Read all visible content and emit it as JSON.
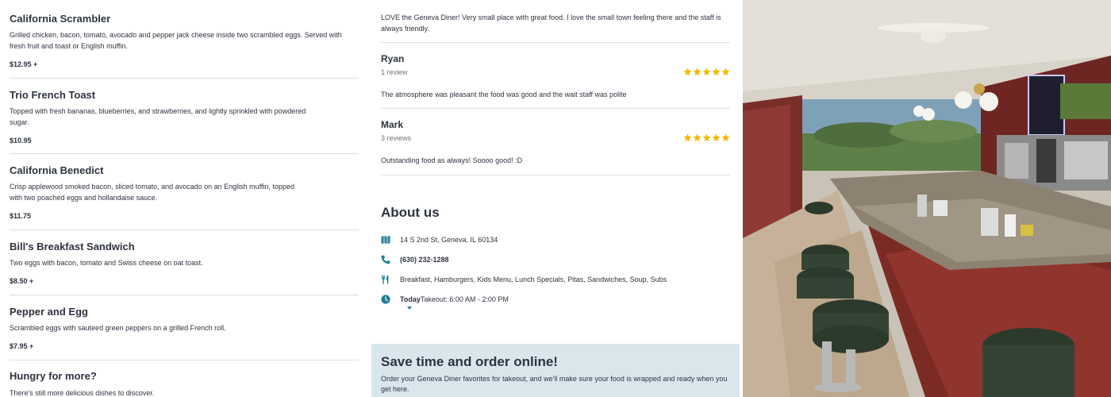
{
  "menu": {
    "items": [
      {
        "name": "California Scrambler",
        "description": "Grilled chicken, bacon, tomato, avocado and pepper jack cheese inside two scrambled eggs. Served with fresh fruit and toast or English muffin.",
        "price": "$12.95 +"
      },
      {
        "name": "Trio French Toast",
        "description": "Topped with fresh bananas, blueberries, and strawberries, and lightly sprinkled with powdered sugar.",
        "price": "$10.95"
      },
      {
        "name": "California Benedict",
        "description": "Crisp applewood smoked bacon, sliced tomato, and avocado on an English muffin, topped with two poached eggs and hollandaise sauce.",
        "price": "$11.75"
      },
      {
        "name": "Bill's Breakfast Sandwich",
        "description": "Two eggs with bacon, tomato and Swiss cheese on oat toast.",
        "price": "$8.50 +"
      },
      {
        "name": "Pepper and Egg",
        "description": "Scrambled eggs with sauteed green peppers on a grilled French roll.",
        "price": "$7.95 +"
      }
    ],
    "more_title": "Hungry for more?",
    "more_subtitle": "There's still more delicious dishes to discover."
  },
  "reviews": {
    "top_text": "LOVE the Geneva Diner! Very small place with great food. I love the small town feeling there and the staff is always friendly.",
    "items": [
      {
        "name": "Ryan",
        "count": "1 review",
        "rating": 5,
        "text": "The atmosphere was pleasant the food was good and the wait staff was polite"
      },
      {
        "name": "Mark",
        "count": "3 reviews",
        "rating": 5,
        "text": "Outstanding food as always! Soooo good! :D"
      }
    ],
    "star_color": "#f5b800"
  },
  "about": {
    "title": "About us",
    "address": "14 S 2nd St, Geneva, IL 60134",
    "phone": "(630) 232-1288",
    "cuisine": "Breakfast, Hamburgers, Kids Menu, Lunch Specials, Pitas, Sandwiches, Soup, Subs",
    "hours_day": "Today",
    "hours_text": "Takeout: 6:00 AM - 2:00 PM",
    "icons": [
      "map-icon",
      "phone-icon",
      "utensils-icon",
      "clock-icon"
    ],
    "accent_color": "#247f9e"
  },
  "order": {
    "title": "Save time and order online!",
    "text": "Order your Geneva Diner favorites for takeout, and we'll make sure your food is wrapped and ready when you get here.",
    "background": "#d9e7ed"
  }
}
